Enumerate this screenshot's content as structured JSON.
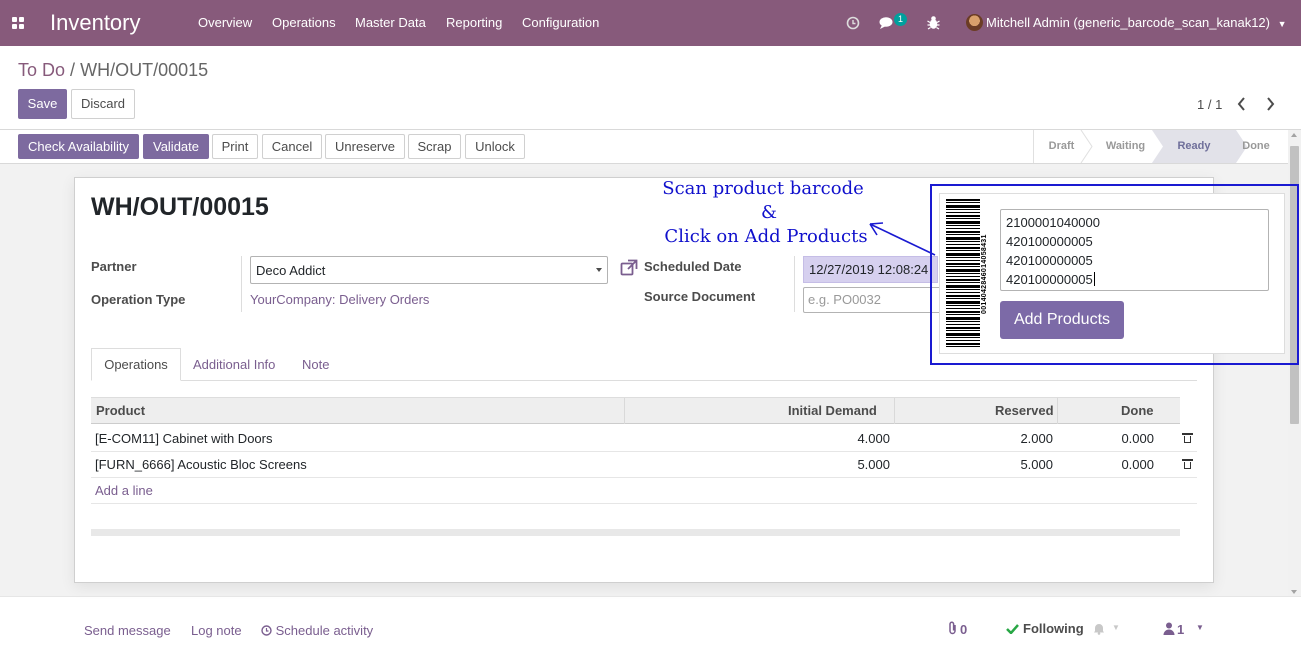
{
  "navbar": {
    "app_name": "Inventory",
    "menus": [
      "Overview",
      "Operations",
      "Master Data",
      "Reporting",
      "Configuration"
    ],
    "messages_count": "1",
    "user_label": "Mitchell Admin (generic_barcode_scan_kanak12)"
  },
  "breadcrumb": {
    "parent": "To Do",
    "separator": "/",
    "current": "WH/OUT/00015"
  },
  "toolbar": {
    "save_label": "Save",
    "discard_label": "Discard",
    "pager": "1 / 1"
  },
  "actions": {
    "check_availability": "Check Availability",
    "validate": "Validate",
    "print": "Print",
    "cancel": "Cancel",
    "unreserve": "Unreserve",
    "scrap": "Scrap",
    "unlock": "Unlock"
  },
  "statusbar": {
    "stages": [
      "Draft",
      "Waiting",
      "Ready",
      "Done"
    ],
    "active": "Ready"
  },
  "record": {
    "name": "WH/OUT/00015",
    "partner_label": "Partner",
    "partner_value": "Deco Addict",
    "operation_type_label": "Operation Type",
    "operation_type_value": "YourCompany: Delivery Orders",
    "scheduled_date_label": "Scheduled Date",
    "scheduled_date_value": "12/27/2019 12:08:24",
    "source_document_label": "Source Document",
    "source_document_placeholder": "e.g. PO0032"
  },
  "tabs": [
    "Operations",
    "Additional Info",
    "Note"
  ],
  "table": {
    "columns": [
      "Product",
      "Initial Demand",
      "Reserved",
      "Done"
    ],
    "rows": [
      {
        "product": "[E-COM11] Cabinet with Doors",
        "initial_demand": "4.000",
        "reserved": "2.000",
        "done": "0.000"
      },
      {
        "product": "[FURN_6666] Acoustic Bloc Screens",
        "initial_demand": "5.000",
        "reserved": "5.000",
        "done": "0.000"
      }
    ],
    "add_line": "Add a line"
  },
  "chatter": {
    "send_message": "Send message",
    "log_note": "Log note",
    "schedule_activity": "Schedule activity",
    "attachments_count": "0",
    "following": "Following",
    "followers_count": "1"
  },
  "annotation": {
    "line1": "Scan product barcode",
    "line2": "&",
    "line3": "Click on Add Products"
  },
  "barcode_popup": {
    "barcode_digits": "0014042846014058431",
    "scanned_codes": [
      "2100001040000",
      "420100000005",
      "420100000005",
      "420100000005"
    ],
    "add_products_label": "Add Products"
  },
  "colors": {
    "brand": "#875a7b",
    "annotation_blue": "#1a1ad1",
    "stage_active": "#6f6f9a"
  }
}
